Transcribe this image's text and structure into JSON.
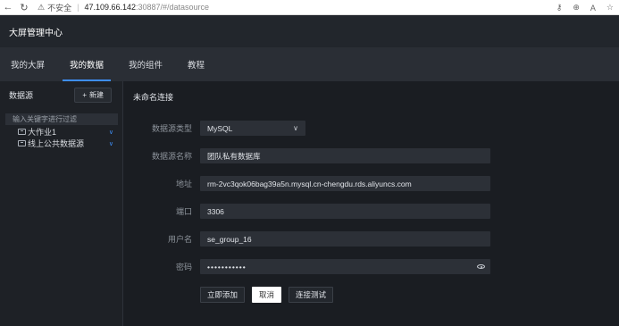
{
  "browser": {
    "back_icon": "arrow-left-icon",
    "refresh_icon": "refresh-icon",
    "warning_icon": "warning-icon",
    "security_label": "不安全",
    "separator": "|",
    "host": "47.109.66.142",
    "path": ":30887/#/datasource",
    "right_icons": [
      "key-icon",
      "zoom-icon",
      "read-aloud-icon",
      "favorite-icon"
    ]
  },
  "app": {
    "title": "大屏管理中心"
  },
  "tabs": [
    {
      "label": "我的大屏",
      "active": false
    },
    {
      "label": "我的数据",
      "active": true
    },
    {
      "label": "我的组件",
      "active": false
    },
    {
      "label": "教程",
      "active": false
    }
  ],
  "sidebar": {
    "title": "数据源",
    "new_button": "新建",
    "filter_placeholder": "输入关键字进行过滤",
    "items": [
      {
        "label": "大作业1"
      },
      {
        "label": "线上公共数据源"
      }
    ]
  },
  "form": {
    "title": "未命名连接",
    "type_label": "数据源类型",
    "type_value": "MySQL",
    "name_label": "数据源名称",
    "name_value": "团队私有数据库",
    "address_label": "地址",
    "address_value": "rm-2vc3qok06bag39a5n.mysql.cn-chengdu.rds.aliyuncs.com",
    "port_label": "端口",
    "port_value": "3306",
    "user_label": "用户名",
    "user_value": "se_group_16",
    "password_label": "密码",
    "password_value": "•••••••••••",
    "submit_button": "立即添加",
    "cancel_button": "取消",
    "test_button": "连接测试"
  }
}
